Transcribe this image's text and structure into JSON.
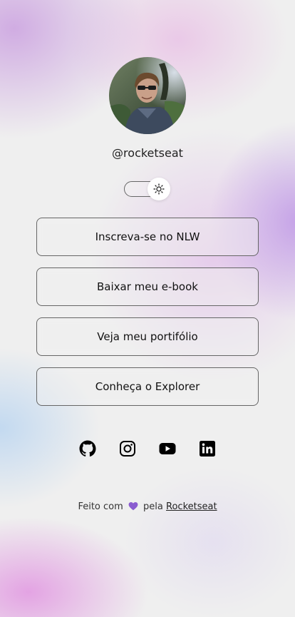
{
  "profile": {
    "avatar_alt": "Foto de perfil",
    "handle": "@rocketseat"
  },
  "theme_switch": {
    "state": "light",
    "icon": "sun-icon"
  },
  "links": [
    {
      "label": "Inscreva-se no NLW"
    },
    {
      "label": "Baixar meu e-book"
    },
    {
      "label": "Veja meu portifólio"
    },
    {
      "label": "Conheça o Explorer"
    }
  ],
  "social": [
    {
      "name": "GitHub",
      "icon": "github-icon"
    },
    {
      "name": "Instagram",
      "icon": "instagram-icon"
    },
    {
      "name": "YouTube",
      "icon": "youtube-icon"
    },
    {
      "name": "LinkedIn",
      "icon": "linkedin-icon"
    }
  ],
  "footer": {
    "prefix": "Feito com",
    "middle": "pela",
    "link_label": "Rocketseat"
  },
  "colors": {
    "heart": "#8a5cd0"
  }
}
